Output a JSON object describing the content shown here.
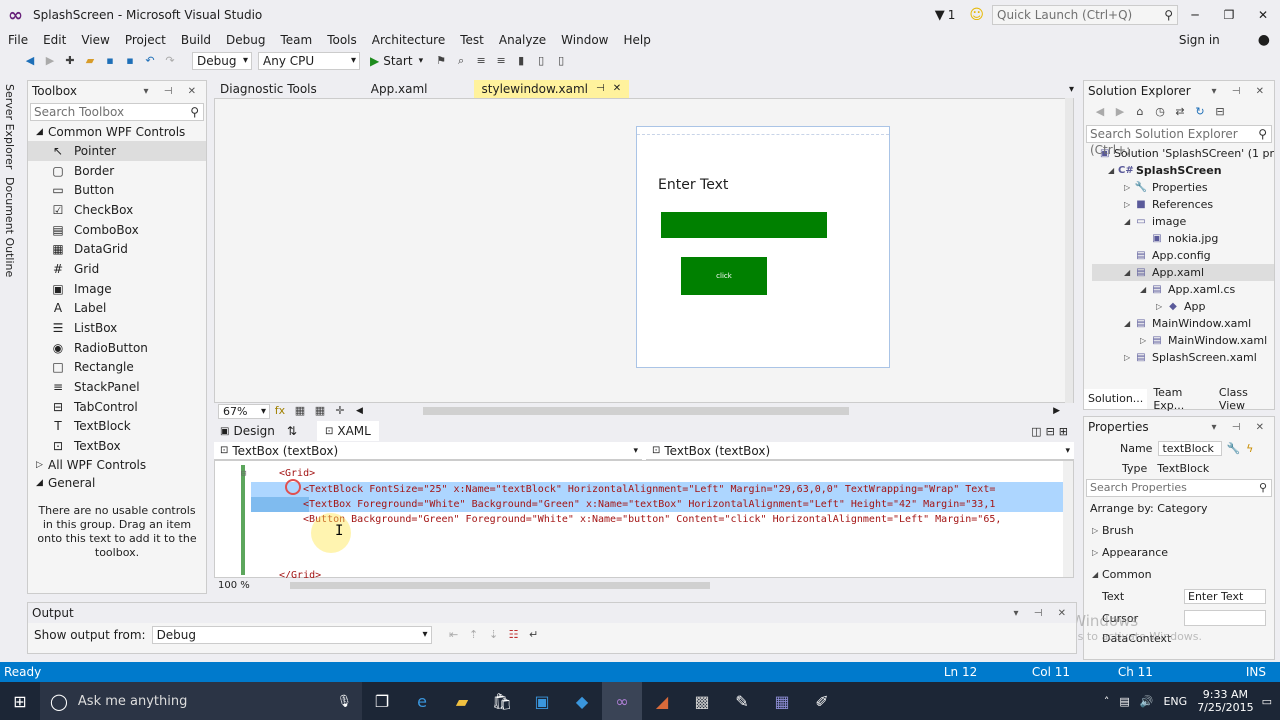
{
  "title": {
    "text": "SplashScreen - Microsoft Visual Studio",
    "notif_count": "1",
    "quick_launch": "Quick Launch (Ctrl+Q)"
  },
  "menu": {
    "items": [
      "File",
      "Edit",
      "View",
      "Project",
      "Build",
      "Debug",
      "Team",
      "Tools",
      "Architecture",
      "Test",
      "Analyze",
      "Window",
      "Help"
    ],
    "sign_in": "Sign in"
  },
  "toolbar": {
    "config": "Debug",
    "platform": "Any CPU",
    "start": "Start"
  },
  "side_tabs": [
    "Server Explorer",
    "Document Outline"
  ],
  "toolbox": {
    "title": "Toolbox",
    "search_placeholder": "Search Toolbox",
    "group_common": "Common WPF Controls",
    "items": [
      {
        "icon": "↖",
        "label": "Pointer"
      },
      {
        "icon": "▢",
        "label": "Border"
      },
      {
        "icon": "▭",
        "label": "Button"
      },
      {
        "icon": "☑",
        "label": "CheckBox"
      },
      {
        "icon": "▤",
        "label": "ComboBox"
      },
      {
        "icon": "▦",
        "label": "DataGrid"
      },
      {
        "icon": "#",
        "label": "Grid"
      },
      {
        "icon": "▣",
        "label": "Image"
      },
      {
        "icon": "A",
        "label": "Label"
      },
      {
        "icon": "☰",
        "label": "ListBox"
      },
      {
        "icon": "◉",
        "label": "RadioButton"
      },
      {
        "icon": "□",
        "label": "Rectangle"
      },
      {
        "icon": "≡",
        "label": "StackPanel"
      },
      {
        "icon": "⊟",
        "label": "TabControl"
      },
      {
        "icon": "T",
        "label": "TextBlock"
      },
      {
        "icon": "⊡",
        "label": "TextBox"
      }
    ],
    "group_all": "All WPF Controls",
    "group_general": "General",
    "general_msg": "There are no usable controls in this group. Drag an item onto this text to add it to the toolbox."
  },
  "doc_tabs": [
    "Diagnostic Tools",
    "App.xaml",
    "stylewindow.xaml"
  ],
  "designer": {
    "enter_text": "Enter Text",
    "button_text": "click",
    "zoom": "67%"
  },
  "split": {
    "design": "Design",
    "xaml": "XAML",
    "left_combo": "TextBox (textBox)",
    "right_combo": "TextBox (textBox)"
  },
  "code": {
    "line_grid": "<Grid>",
    "line1": "<TextBlock FontSize=\"25\" x:Name=\"textBlock\" HorizontalAlignment=\"Left\" Margin=\"29,63,0,0\" TextWrapping=\"Wrap\" Text=",
    "line2": "<TextBox Foreground=\"White\" Background=\"Green\" x:Name=\"textBox\" HorizontalAlignment=\"Left\" Height=\"42\" Margin=\"33,1",
    "line3": "<Button Background=\"Green\" Foreground=\"White\" x:Name=\"button\" Content=\"click\" HorizontalAlignment=\"Left\" Margin=\"65,",
    "line_end": "</Grid>",
    "zoom": "100 %"
  },
  "solution": {
    "title": "Solution Explorer",
    "search_placeholder": "Search Solution Explorer (Ctrl+;",
    "nodes": [
      {
        "indent": 0,
        "tri": "",
        "icon": "▣",
        "label": "Solution 'SplashSCreen' (1 pr",
        "bold": false
      },
      {
        "indent": 1,
        "tri": "◢",
        "icon": "C#",
        "label": "SplashSCreen",
        "bold": true
      },
      {
        "indent": 2,
        "tri": "▷",
        "icon": "🔧",
        "label": "Properties",
        "bold": false
      },
      {
        "indent": 2,
        "tri": "▷",
        "icon": "■",
        "label": "References",
        "bold": false
      },
      {
        "indent": 2,
        "tri": "◢",
        "icon": "▭",
        "label": "image",
        "bold": false
      },
      {
        "indent": 3,
        "tri": "",
        "icon": "▣",
        "label": "nokia.jpg",
        "bold": false
      },
      {
        "indent": 2,
        "tri": "",
        "icon": "▤",
        "label": "App.config",
        "bold": false
      },
      {
        "indent": 2,
        "tri": "◢",
        "icon": "▤",
        "label": "App.xaml",
        "bold": false,
        "selected": true
      },
      {
        "indent": 3,
        "tri": "◢",
        "icon": "▤",
        "label": "App.xaml.cs",
        "bold": false
      },
      {
        "indent": 4,
        "tri": "▷",
        "icon": "◆",
        "label": "App",
        "bold": false
      },
      {
        "indent": 2,
        "tri": "◢",
        "icon": "▤",
        "label": "MainWindow.xaml",
        "bold": false
      },
      {
        "indent": 3,
        "tri": "▷",
        "icon": "▤",
        "label": "MainWindow.xaml",
        "bold": false
      },
      {
        "indent": 2,
        "tri": "▷",
        "icon": "▤",
        "label": "SplashScreen.xaml",
        "bold": false
      }
    ],
    "tabs": [
      "Solution...",
      "Team Exp...",
      "Class View"
    ]
  },
  "properties": {
    "title": "Properties",
    "name_label": "Name",
    "name_value": "textBlock",
    "type_label": "Type",
    "type_value": "TextBlock",
    "search_placeholder": "Search Properties",
    "arrange": "Arrange by: Category",
    "cats": [
      "Brush",
      "Appearance",
      "Common"
    ],
    "text_label": "Text",
    "text_value": "Enter Text",
    "cursor_label": "Cursor",
    "datacontext_label": "DataContext"
  },
  "watermark": {
    "line1": "Activate Windows",
    "line2": "Go to Settings to activate Windows."
  },
  "output": {
    "title": "Output",
    "show_label": "Show output from:",
    "show_value": "Debug"
  },
  "status": {
    "ready": "Ready",
    "ln": "Ln 12",
    "col": "Col 11",
    "ch": "Ch 11",
    "ins": "INS"
  },
  "taskbar": {
    "search": "Ask me anything",
    "lang": "ENG",
    "time": "9:33 AM",
    "date": "7/25/2015"
  },
  "colors": {
    "accent": "#007acc",
    "green": "#008000",
    "highlight": "#fff29d"
  }
}
